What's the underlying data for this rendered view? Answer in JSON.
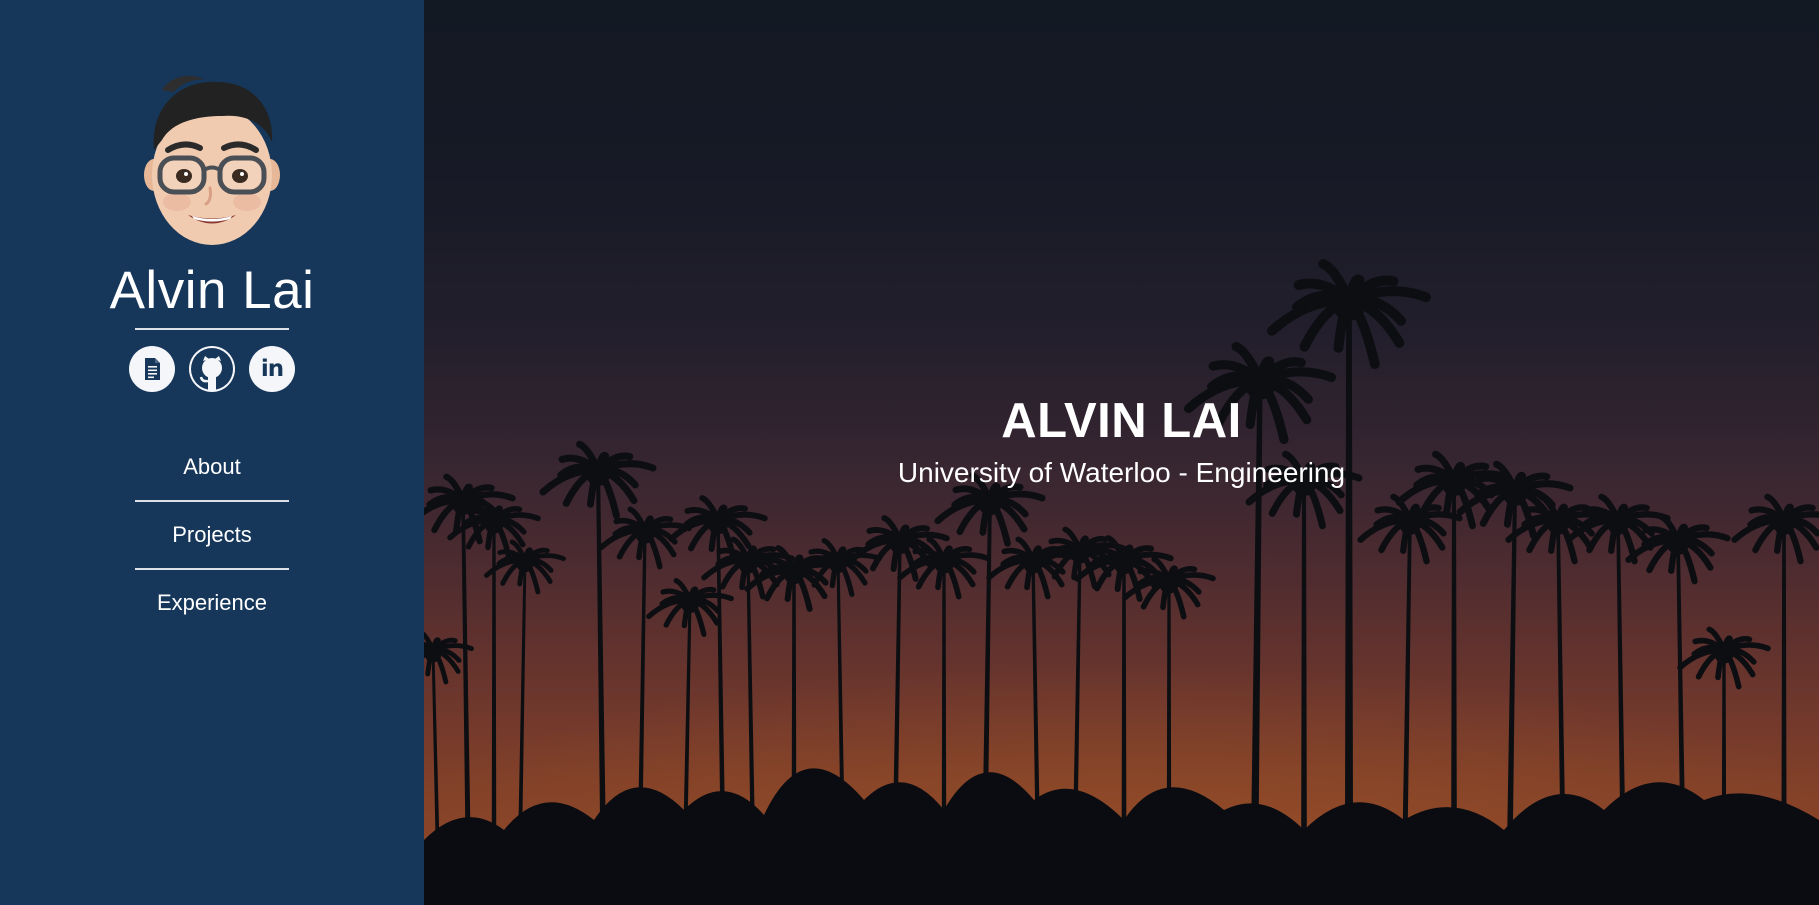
{
  "sidebar": {
    "name": "Alvin Lai",
    "social": [
      {
        "name": "resume",
        "icon": "document-icon"
      },
      {
        "name": "github",
        "icon": "github-icon"
      },
      {
        "name": "linkedin",
        "icon": "linkedin-icon",
        "glyph": "in"
      }
    ],
    "nav": [
      {
        "label": "About"
      },
      {
        "label": "Projects"
      },
      {
        "label": "Experience"
      }
    ]
  },
  "hero": {
    "title": "ALVIN LAI",
    "subtitle": "University of Waterloo - Engineering"
  },
  "colors": {
    "sidebar_bg": "#16365a",
    "icon_circle": "#f4f6f9",
    "icon_glyph": "#16365a",
    "text": "#ffffff"
  }
}
